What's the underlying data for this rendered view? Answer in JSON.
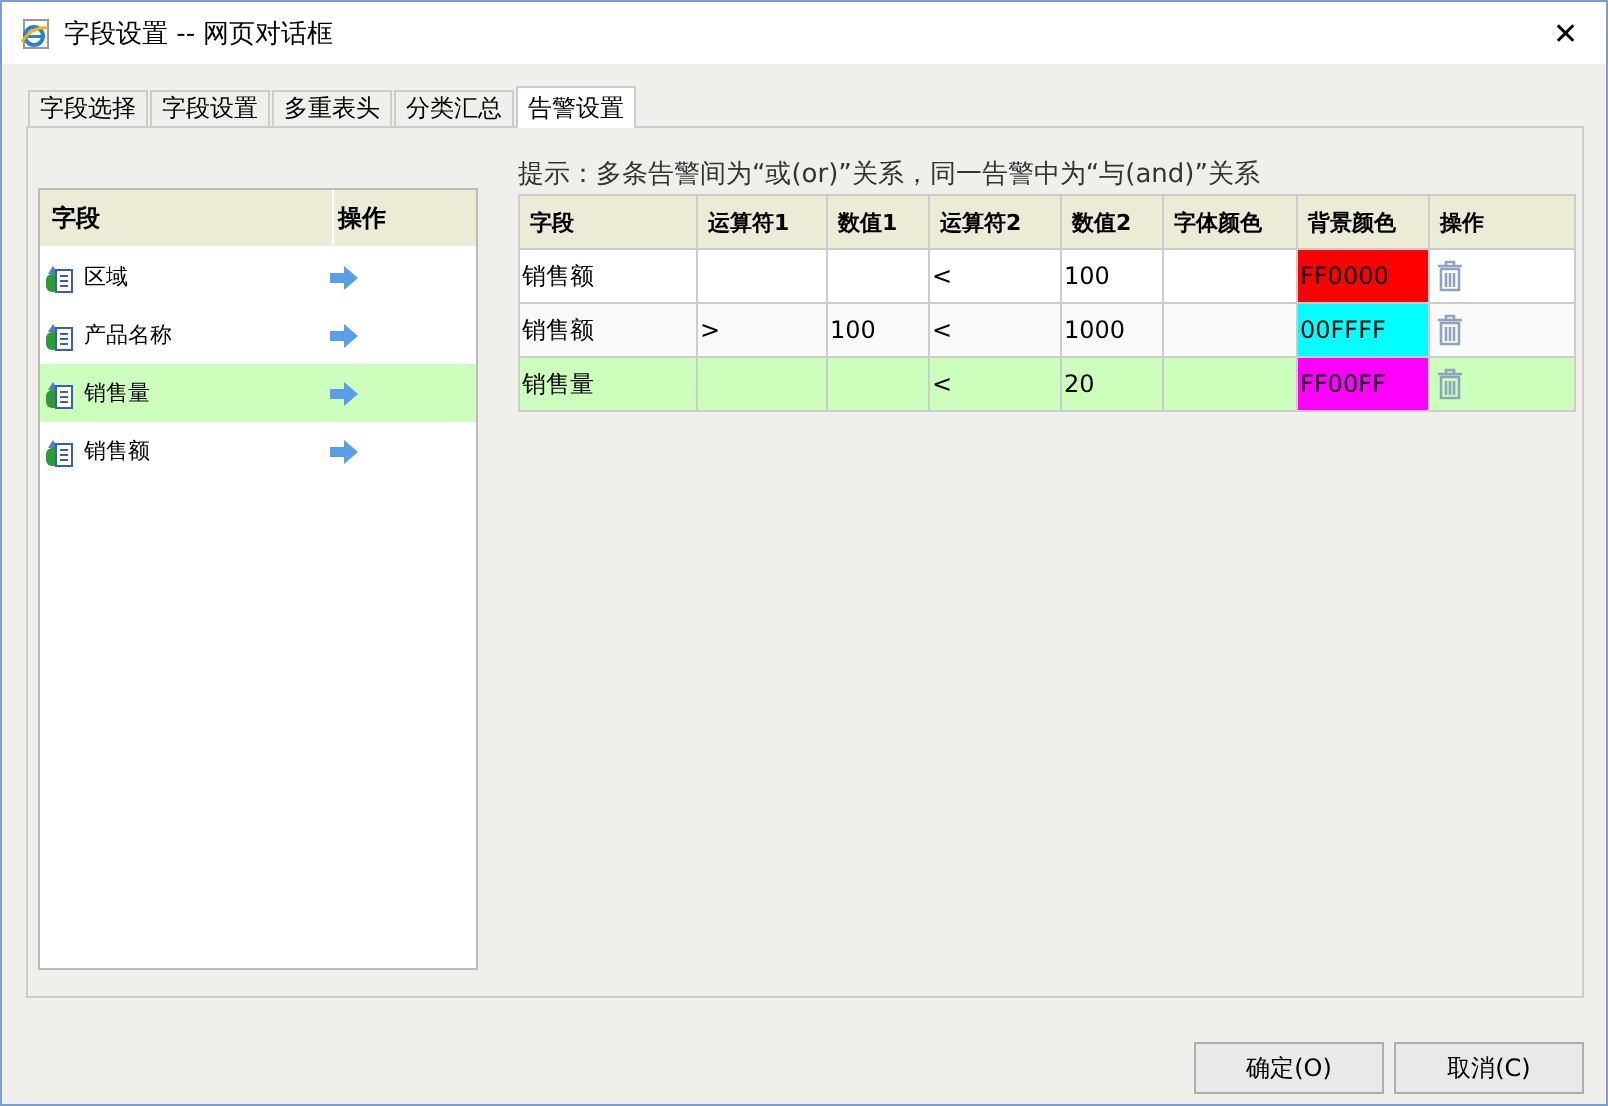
{
  "window": {
    "title": "字段设置 -- 网页对话框",
    "close": "✕"
  },
  "tabs": [
    {
      "label": "字段选择",
      "selected": false
    },
    {
      "label": "字段设置",
      "selected": false
    },
    {
      "label": "多重表头",
      "selected": false
    },
    {
      "label": "分类汇总",
      "selected": false
    },
    {
      "label": "告警设置",
      "selected": true
    }
  ],
  "field_list": {
    "columns": [
      "字段",
      "操作"
    ],
    "items": [
      {
        "name": "区域",
        "selected": false
      },
      {
        "name": "产品名称",
        "selected": false
      },
      {
        "name": "销售量",
        "selected": true
      },
      {
        "name": "销售额",
        "selected": false
      }
    ]
  },
  "hint": "提示：多条告警间为“或(or)”关系，同一告警中为“与(and)”关系",
  "alarm_table": {
    "columns": [
      "字段",
      "运算符1",
      "数值1",
      "运算符2",
      "数值2",
      "字体颜色",
      "背景颜色",
      "操作"
    ],
    "rows": [
      {
        "field": "销售额",
        "op1": "",
        "value1": "",
        "op2": "<",
        "value2": "100",
        "font_color": "",
        "bg_color": "FF0000",
        "color": "#ff0000",
        "selected": false
      },
      {
        "field": "销售额",
        "op1": ">",
        "value1": "100",
        "op2": "<",
        "value2": "1000",
        "font_color": "",
        "bg_color": "00FFFF",
        "color": "#00ffff",
        "selected": false
      },
      {
        "field": "销售量",
        "op1": "",
        "value1": "",
        "op2": "<",
        "value2": "20",
        "font_color": "",
        "bg_color": "FF00FF",
        "color": "#ff00ff",
        "selected": true
      }
    ]
  },
  "buttons": [
    "确定(O)",
    "取消(C)"
  ]
}
